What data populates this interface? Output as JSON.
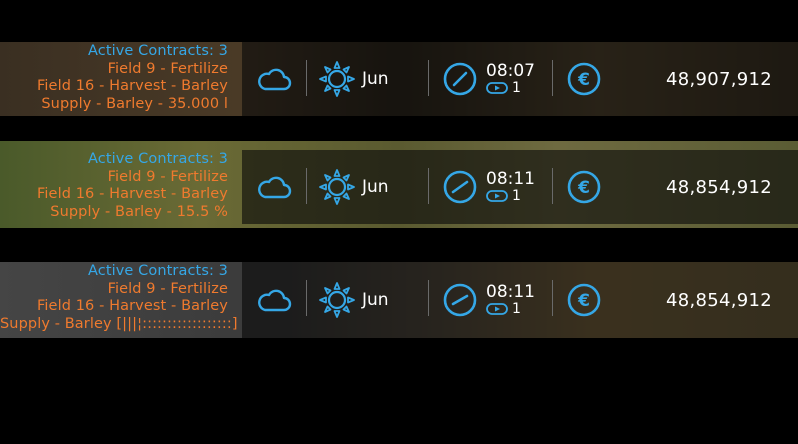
{
  "rows": [
    {
      "contracts": {
        "title": "Active Contracts: 3",
        "lines": [
          "Field 9 - Fertilize",
          "Field 16 - Harvest - Barley",
          "Supply - Barley - 35.000 l"
        ]
      },
      "weather_icon": "cloud-icon",
      "season_icon": "sun-icon",
      "month": "Jun",
      "clock_icon": "clock-icon",
      "time": "08:07",
      "time_speed": "1",
      "currency_icon": "euro-icon",
      "money": "48,907,912"
    },
    {
      "contracts": {
        "title": "Active Contracts: 3",
        "lines": [
          "Field 9 - Fertilize",
          "Field 16 - Harvest - Barley",
          "Supply - Barley - 15.5 %"
        ]
      },
      "weather_icon": "cloud-icon",
      "season_icon": "sun-icon",
      "month": "Jun",
      "clock_icon": "clock-icon",
      "time": "08:11",
      "time_speed": "1",
      "currency_icon": "euro-icon",
      "money": "48,854,912"
    },
    {
      "contracts": {
        "title": "Active Contracts: 3",
        "lines": [
          "Field 9 - Fertilize",
          "Field 16 - Harvest - Barley",
          "Supply - Barley [|||¦::::::::::::::::::]"
        ]
      },
      "weather_icon": "cloud-icon",
      "season_icon": "sun-icon",
      "month": "Jun",
      "clock_icon": "clock-icon",
      "time": "08:11",
      "time_speed": "1",
      "currency_icon": "euro-icon",
      "money": "48,854,912"
    }
  ],
  "colors": {
    "accent": "#35a7e6",
    "contract_text": "#ef7a2e",
    "title_text": "#35a7e6"
  }
}
